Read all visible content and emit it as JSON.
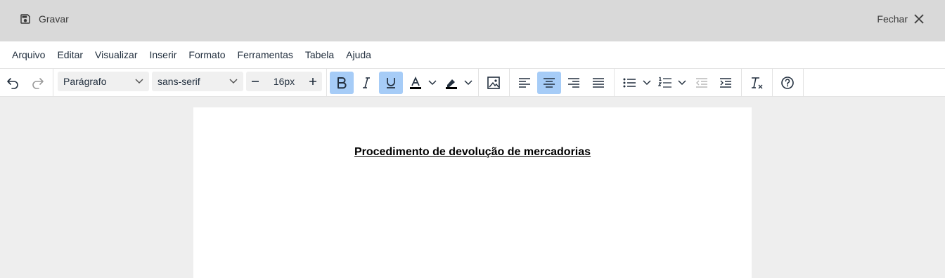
{
  "topbar": {
    "save_label": "Gravar",
    "close_label": "Fechar"
  },
  "menubar": {
    "items": [
      "Arquivo",
      "Editar",
      "Visualizar",
      "Inserir",
      "Formato",
      "Ferramentas",
      "Tabela",
      "Ajuda"
    ]
  },
  "toolbar": {
    "block_format": "Parágrafo",
    "font_family": "sans-serif",
    "font_size": "16px",
    "active_buttons": [
      "bold",
      "underline",
      "align-center"
    ],
    "accent_color": "#a6ccf7"
  },
  "document": {
    "title": "Procedimento de devolução de mercadorias"
  }
}
